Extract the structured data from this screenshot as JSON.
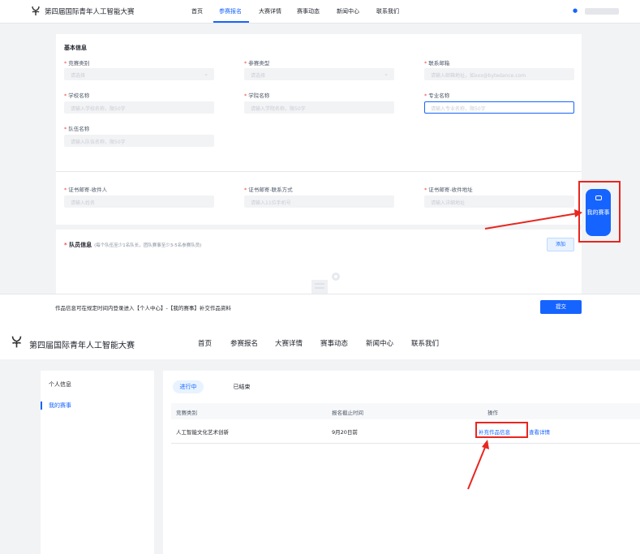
{
  "panel1": {
    "brand": "第四届国际青年人工智能大赛",
    "nav": [
      "首页",
      "参赛报名",
      "大赛详情",
      "赛事动态",
      "新闻中心",
      "联系我们"
    ],
    "nav_active": "参赛报名",
    "basic_title": "基本信息",
    "fields": {
      "category": {
        "label": "竞赛类别",
        "placeholder": "请选择"
      },
      "type": {
        "label": "参赛类型",
        "placeholder": "请选择"
      },
      "email": {
        "label": "联系邮箱",
        "placeholder": "请输入邮箱地址，如xxx@bytedance.com"
      },
      "school": {
        "label": "学校名称",
        "placeholder": "请输入学校名称，限50字"
      },
      "college": {
        "label": "学院名称",
        "placeholder": "请输入学院名称，限50字"
      },
      "major": {
        "label": "专业名称",
        "placeholder": "请输入专业名称，限50字"
      },
      "team": {
        "label": "队伍名称",
        "placeholder": "请输入队伍名称，限50字"
      },
      "recipient": {
        "label": "证书邮寄-收件人",
        "placeholder": "请输入姓名"
      },
      "contact": {
        "label": "证书邮寄-联系方式",
        "placeholder": "请输入11位手机号"
      },
      "address": {
        "label": "证书邮寄-收件地址",
        "placeholder": "请输入详细地址"
      }
    },
    "members_title": "队员信息",
    "members_hint": "(每个队伍至少1名队长，团队赛事至少3-5名参赛队员)",
    "add_label": "添加",
    "float_label": "我的赛事",
    "bottom_note": "作品信息可在规定时间内登录进入【个人中心】-【我的赛事】补交作品资料",
    "submit_label": "提交",
    "colors": {
      "accent": "#1664ff",
      "annotation": "#e8261f"
    }
  },
  "panel2": {
    "brand": "第四届国际青年人工智能大赛",
    "nav": [
      "首页",
      "参赛报名",
      "大赛详情",
      "赛事动态",
      "新闻中心",
      "联系我们"
    ],
    "sidebar": [
      "个人信息",
      "我的赛事"
    ],
    "sidebar_active": "我的赛事",
    "tabs": [
      "进行中",
      "已结束"
    ],
    "tab_active": "进行中",
    "columns": [
      "竞赛类别",
      "报名截止时间",
      "操作"
    ],
    "rows": [
      {
        "category": "人工智能文化艺术创新",
        "deadline": "9月20日前",
        "action_primary": "补充作品信息",
        "action_secondary": "查看详情"
      }
    ]
  }
}
